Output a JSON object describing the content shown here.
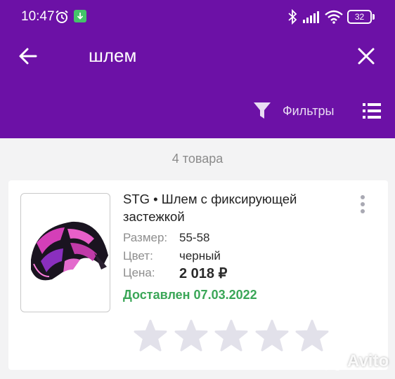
{
  "status_bar": {
    "time": "10:47",
    "battery": "32"
  },
  "colors": {
    "header_bg": "#6c11a6",
    "delivered": "#3aa657",
    "star": "#e2e1ea"
  },
  "search": {
    "query": "шлем"
  },
  "toolbar": {
    "filters_label": "Фильтры"
  },
  "results": {
    "count_label": "4 товара"
  },
  "product": {
    "title": "STG • Шлем с фиксирующей застежкой",
    "size_label": "Размер:",
    "size_value": "55-58",
    "color_label": "Цвет:",
    "color_value": "черный",
    "price_label": "Цена:",
    "price_value": "2 018 ₽",
    "delivery_status": "Доставлен 07.03.2022",
    "rating": 0,
    "rating_max": 5
  },
  "watermark": {
    "text": "Avito"
  },
  "icons": [
    "alarm-icon",
    "download-icon",
    "bluetooth-icon",
    "signal-icon",
    "wifi-icon",
    "battery-icon",
    "back-arrow-icon",
    "close-icon",
    "filter-icon",
    "list-view-icon",
    "more-vertical-icon",
    "star-icon",
    "avito-logo-icon"
  ]
}
